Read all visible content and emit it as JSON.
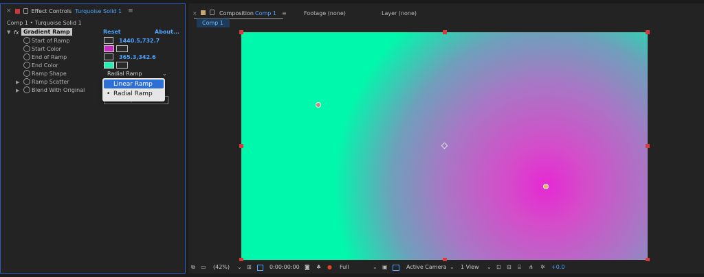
{
  "effect_panel": {
    "close": "×",
    "title": "Effect Controls",
    "layer": "Turquoise Solid 1",
    "menu": "≡",
    "breadcrumb": "Comp 1 • Turquoise Solid 1",
    "effect_name": "Gradient Ramp",
    "reset": "Reset",
    "about": "About...",
    "fx": "fx",
    "props": {
      "start_of_ramp": {
        "label": "Start of Ramp",
        "value": "1440.5,732.7"
      },
      "start_color": {
        "label": "Start Color",
        "color": "#c42dbd"
      },
      "end_of_ramp": {
        "label": "End of Ramp",
        "value": "365.3,342.6"
      },
      "end_color": {
        "label": "End Color",
        "color": "#22f0b4"
      },
      "ramp_shape": {
        "label": "Ramp Shape",
        "value": "Radial Ramp"
      },
      "ramp_scatter": {
        "label": "Ramp Scatter"
      },
      "blend": {
        "label": "Blend With Original"
      }
    },
    "swap_colors": "Swap Colors",
    "dropdown": {
      "options": [
        "Linear Ramp",
        "Radial Ramp"
      ],
      "bullet": "•"
    }
  },
  "comp_panel": {
    "close": "×",
    "title": "Composition",
    "comp_name": "Comp 1",
    "menu": "≡",
    "footage": "Footage (none)",
    "layer": "Layer (none)",
    "comp_tab": "Comp 1",
    "colors": {
      "accent": "#4ea3ff",
      "handle": "#d23c3c",
      "start": "#00f8ac",
      "end": "#e629d4"
    }
  },
  "bottom_bar": {
    "zoom": "(42%)",
    "timecode": "0:00:00:00",
    "resolution": "Full",
    "camera": "Active Camera",
    "views": "1 View",
    "exposure": "+0.0"
  }
}
